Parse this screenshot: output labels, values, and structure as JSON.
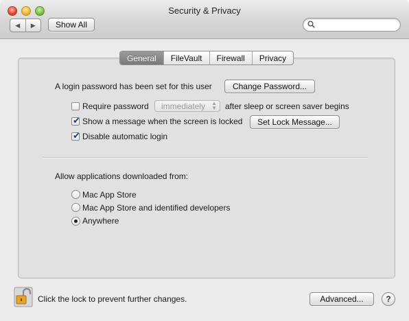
{
  "window": {
    "title": "Security & Privacy"
  },
  "toolbar": {
    "back_icon": "back-arrow-icon",
    "forward_icon": "forward-arrow-icon",
    "show_all_label": "Show All",
    "search_placeholder": "",
    "search_value": ""
  },
  "tabs": [
    {
      "label": "General",
      "active": true
    },
    {
      "label": "FileVault",
      "active": false
    },
    {
      "label": "Firewall",
      "active": false
    },
    {
      "label": "Privacy",
      "active": false
    }
  ],
  "general": {
    "login_password_text": "A login password has been set for this user",
    "change_password_label": "Change Password...",
    "require_password_label": "Require password",
    "require_password_checked": false,
    "require_password_delay": "immediately",
    "require_password_suffix": "after sleep or screen saver begins",
    "show_message_label": "Show a message when the screen is locked",
    "show_message_checked": true,
    "set_lock_message_label": "Set Lock Message...",
    "disable_auto_login_label": "Disable automatic login",
    "disable_auto_login_checked": true,
    "allow_apps_heading": "Allow applications downloaded from:",
    "allow_apps_options": [
      {
        "label": "Mac App Store",
        "selected": false
      },
      {
        "label": "Mac App Store and identified developers",
        "selected": false
      },
      {
        "label": "Anywhere",
        "selected": true
      }
    ]
  },
  "footer": {
    "lock_icon": "unlocked-padlock-icon",
    "lock_text": "Click the lock to prevent further changes.",
    "advanced_label": "Advanced...",
    "help_label": "?"
  },
  "colors": {
    "window_bg": "#ececec",
    "panel_bg": "#e1e1e1",
    "active_tab": "#8a8a8a",
    "checkmark": "#1d3f86"
  }
}
